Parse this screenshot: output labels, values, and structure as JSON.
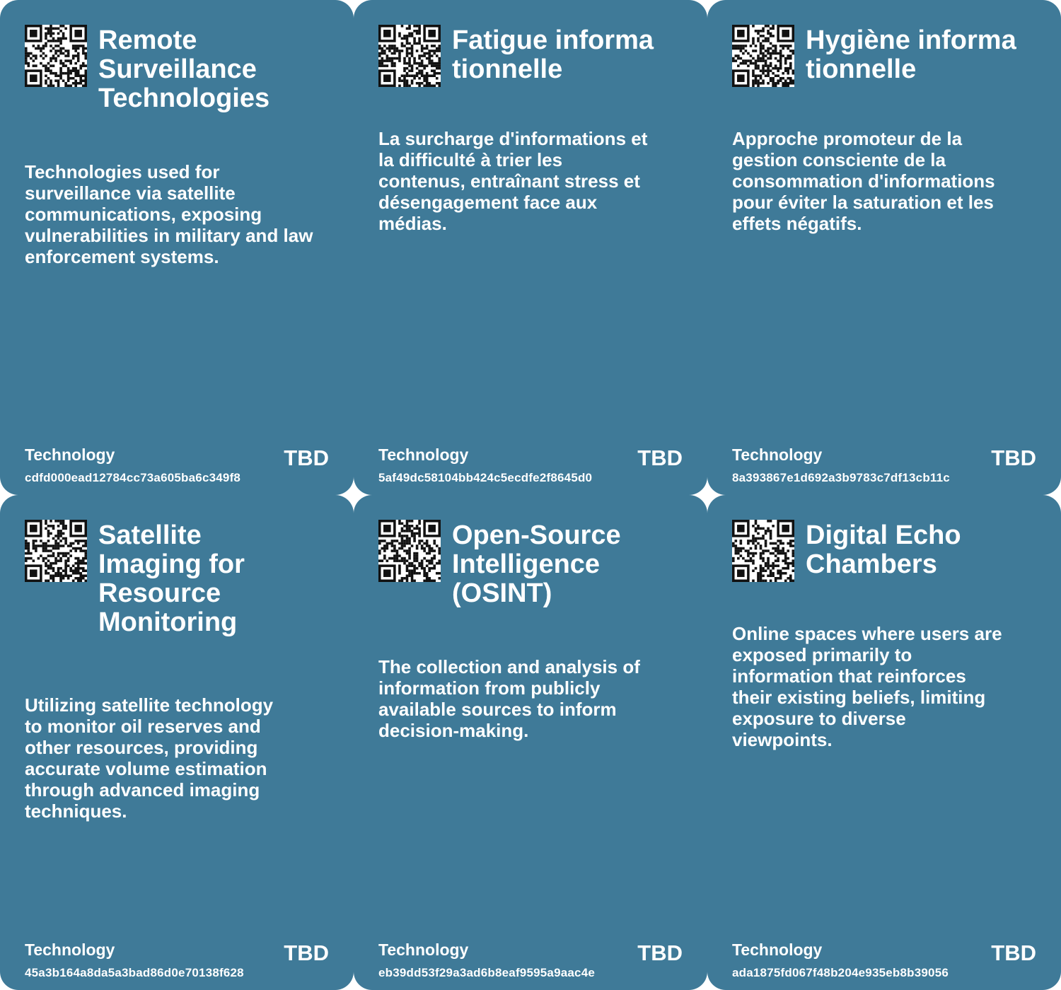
{
  "colors": {
    "card_background": "#3f7a98",
    "text": "#ffffff",
    "qr_dark": "#111111",
    "qr_light": "#ffffff",
    "page_background": "#ffffff"
  },
  "cards": [
    {
      "title": "Remote Surveillance Technologies",
      "description": "Technologies used for surveillance via satellite communications, exposing vulnerabilities in military and law enforcement systems.",
      "category": "Technology",
      "status": "TBD",
      "id": "cdfd000ead12784cc73a605ba6c349f8"
    },
    {
      "title": "Fatigue informationnelle",
      "description": "La surcharge d'informations et la difficulté à trier les contenus, entraînant stress et désengagement face aux médias.",
      "category": "Technology",
      "status": "TBD",
      "id": "5af49dc58104bb424c5ecdfe2f8645d0"
    },
    {
      "title": "Hygiène informationnelle",
      "description": "Approche promoteur de la gestion consciente de la consommation d'informations pour éviter la saturation et les effets négatifs.",
      "category": "Technology",
      "status": "TBD",
      "id": "8a393867e1d692a3b9783c7df13cb11c"
    },
    {
      "title": "Satellite Imaging for Resource Monitoring",
      "description": "Utilizing satellite technology to monitor oil reserves and other resources, providing accurate volume estimation through advanced imaging techniques.",
      "category": "Technology",
      "status": "TBD",
      "id": "45a3b164a8da5a3bad86d0e70138f628"
    },
    {
      "title": "Open-Source Intelligence (OSINT)",
      "description": "The collection and analysis of information from publicly available sources to inform decision-making.",
      "category": "Technology",
      "status": "TBD",
      "id": "eb39dd53f29a3ad6b8eaf9595a9aac4e"
    },
    {
      "title": "Digital Echo Chambers",
      "description": "Online spaces where users are exposed primarily to information that reinforces their existing beliefs, limiting exposure to diverse viewpoints.",
      "category": "Technology",
      "status": "TBD",
      "id": "ada1875fd067f48b204e935eb8b39056"
    }
  ]
}
